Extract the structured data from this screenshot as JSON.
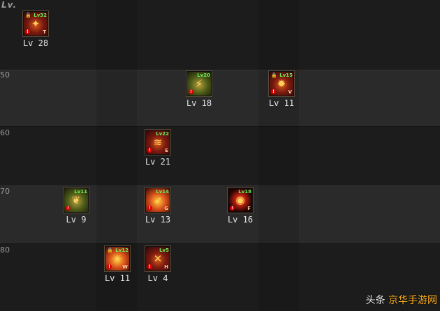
{
  "header": {
    "title": "Lv."
  },
  "rows": [
    {
      "label": ""
    },
    {
      "label": "50"
    },
    {
      "label": "60"
    },
    {
      "label": "70"
    },
    {
      "label": "80"
    }
  ],
  "skills": [
    {
      "req": "Lv32",
      "key": "T",
      "level": "Lv 28",
      "locked": true,
      "glyph": "✦"
    },
    {
      "req": "Lv20",
      "key": "",
      "level": "Lv 18",
      "locked": false,
      "glyph": "⚡"
    },
    {
      "req": "Lv15",
      "key": "V",
      "level": "Lv 11",
      "locked": true,
      "glyph": "✹"
    },
    {
      "req": "Lv22",
      "key": "E",
      "level": "Lv 21",
      "locked": false,
      "glyph": "≋"
    },
    {
      "req": "Lv11",
      "key": "",
      "level": "Lv 9",
      "locked": false,
      "glyph": "❦"
    },
    {
      "req": "Lv14",
      "key": "G",
      "level": "Lv 13",
      "locked": false,
      "glyph": "➶"
    },
    {
      "req": "Lv18",
      "key": "F",
      "level": "Lv 16",
      "locked": false,
      "glyph": "◉"
    },
    {
      "req": "Lv12",
      "key": "W",
      "level": "Lv 11",
      "locked": true,
      "glyph": "☀"
    },
    {
      "req": "Lv5",
      "key": "H",
      "level": "Lv 4",
      "locked": false,
      "glyph": "✕"
    }
  ],
  "watermark": {
    "prefix": "头条",
    "text": "京华手游网"
  }
}
